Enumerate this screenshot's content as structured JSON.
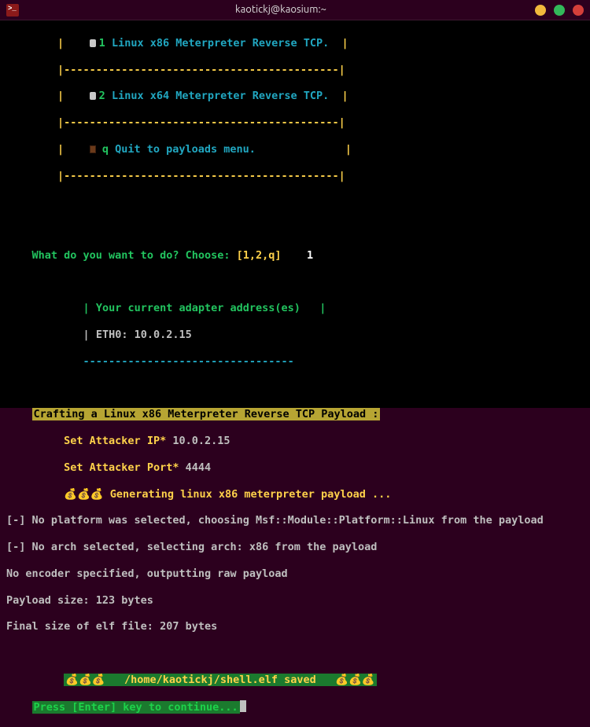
{
  "window": {
    "title": "kaotickj@kaosium:~"
  },
  "menu": {
    "opt1": {
      "num": "1",
      "label": "Linux x86 Meterpreter Reverse TCP."
    },
    "opt2": {
      "num": "2",
      "label": "Linux x64 Meterpreter Reverse TCP."
    },
    "optQ": {
      "num": "q",
      "label": "Quit to payloads menu."
    }
  },
  "prompt": {
    "question": "What do you want to do? Choose:",
    "options": "[1,2,q]",
    "answer": "1"
  },
  "adapter": {
    "header": "Your current adapter address(es)",
    "eth0_label": "ETH0:",
    "eth0_value": "10.0.2.15",
    "dash_line": "---------------------------------"
  },
  "craft": {
    "banner": "Crafting a Linux x86 Meterpreter Reverse TCP Payload :",
    "set_ip_label": "Set Attacker IP*",
    "set_ip_value": "10.0.2.15",
    "set_port_label": "Set Attacker Port*",
    "set_port_value": "4444",
    "gen_emoji": "💰💰💰",
    "gen_text": "Generating linux x86 meterpreter payload ..."
  },
  "output": {
    "l1": "[-] No platform was selected, choosing Msf::Module::Platform::Linux from the payload",
    "l2": "[-] No arch selected, selecting arch: x86 from the payload",
    "l3": "No encoder specified, outputting raw payload",
    "l4": "Payload size: 123 bytes",
    "l5": "Final size of elf file: 207 bytes"
  },
  "saved": {
    "emoji": "💰💰💰",
    "path": "/home/kaotickj/shell.elf saved"
  },
  "continue": {
    "text": "Press [Enter] key to continue..."
  },
  "menu_border": {
    "top": "        |-------------------------------------------|",
    "blank": "        |                                           |"
  }
}
